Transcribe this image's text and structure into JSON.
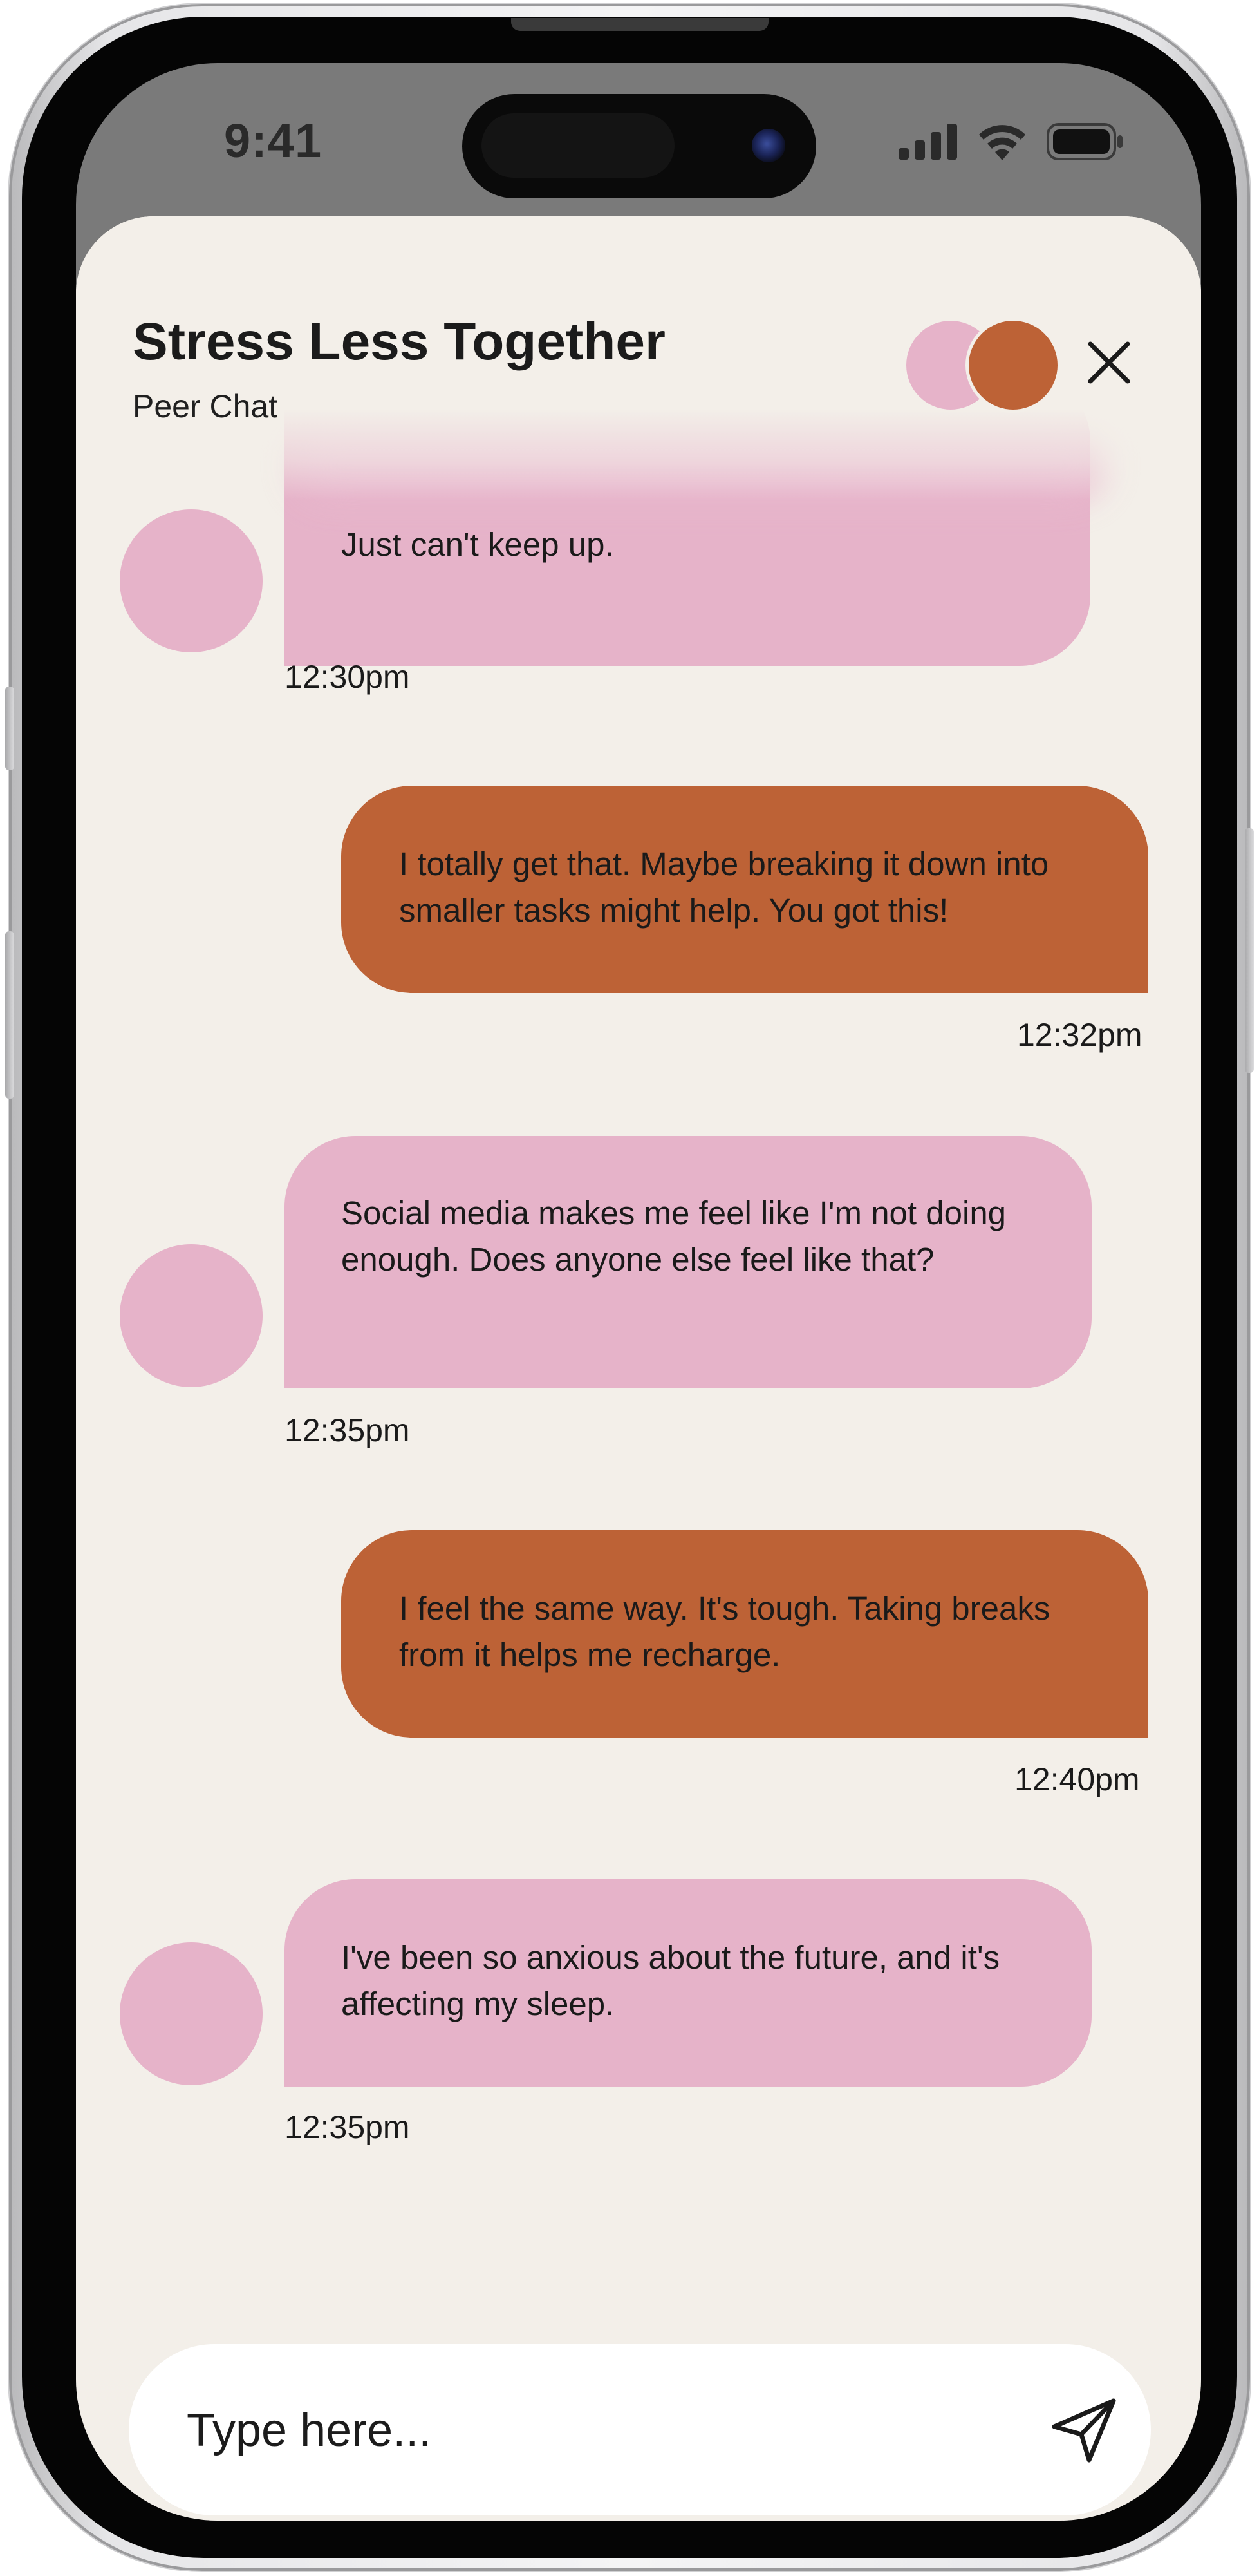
{
  "status_bar": {
    "time": "9:41"
  },
  "header": {
    "title": "Stress Less Together",
    "subtitle": "Peer Chat",
    "participants": [
      {
        "color": "#e6b3c9"
      },
      {
        "color": "#bd6236"
      }
    ],
    "close_icon": "close-icon"
  },
  "messages": [
    {
      "from": "peer",
      "text": "Just can't keep up.",
      "time": "12:30pm"
    },
    {
      "from": "me",
      "text": "I totally get that. Maybe breaking it down into smaller tasks might help. You got this!",
      "time": "12:32pm"
    },
    {
      "from": "peer",
      "text": "Social media makes me feel like I'm not doing enough. Does anyone else feel like that?",
      "time": "12:35pm"
    },
    {
      "from": "me",
      "text": "I feel the same way. It's tough. Taking breaks from it helps me recharge.",
      "time": "12:40pm"
    },
    {
      "from": "peer",
      "text": "I've been so anxious about the future, and it's affecting my sleep.",
      "time": "12:35pm"
    }
  ],
  "composer": {
    "placeholder": "Type here...",
    "send_icon": "send-icon"
  },
  "colors": {
    "background": "#f3efe9",
    "peer_bubble": "#e6b3c9",
    "my_bubble": "#bd6236",
    "composer": "#ffffff"
  }
}
